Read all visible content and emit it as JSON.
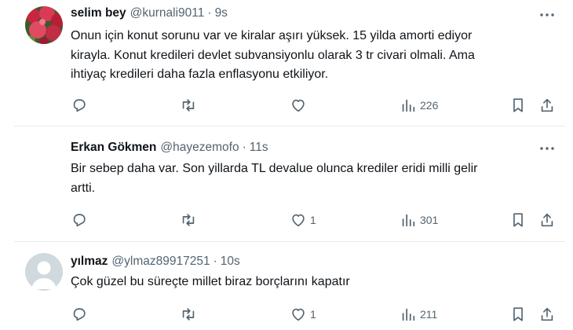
{
  "tweets": [
    {
      "name": "selim bey",
      "handle": "@kurnali9011",
      "separator": "·",
      "time": "9s",
      "text": "Onun için konut sorunu var ve kiralar aşırı yüksek. 15 yilda amorti ediyor\nkirayla. Konut kredileri devlet subvansiyonlu olarak 3 tr civari olmali. Ama\nihtiyaç kredileri daha fazla enflasyonu etkiliyor.",
      "likes": "",
      "views": "226",
      "avatar_icon": "red-flowers-photo-avatar"
    },
    {
      "name": "Erkan Gökmen",
      "handle": "@hayezemofo",
      "separator": "·",
      "time": "11s",
      "text": "Bir sebep daha var. Son yillarda TL devalue olunca krediler eridi milli gelir\nartti.",
      "likes": "1",
      "views": "301",
      "avatar_icon": "none"
    },
    {
      "name": "yılmaz",
      "handle": "@ylmaz89917251",
      "separator": "·",
      "time": "10s",
      "text": "Çok güzel bu süreçte millet biraz borçlarını kapatır",
      "likes": "1",
      "views": "211",
      "avatar_icon": "default-person-avatar"
    }
  ],
  "icons": {
    "more": "more-dots-icon",
    "reply": "reply-icon",
    "retweet": "retweet-icon",
    "like": "heart-icon",
    "views": "views-chart-icon",
    "bookmark": "bookmark-icon",
    "share": "share-icon"
  },
  "colors": {
    "text": "#0f1419",
    "secondary": "#536471",
    "divider": "#e6e9ec"
  }
}
